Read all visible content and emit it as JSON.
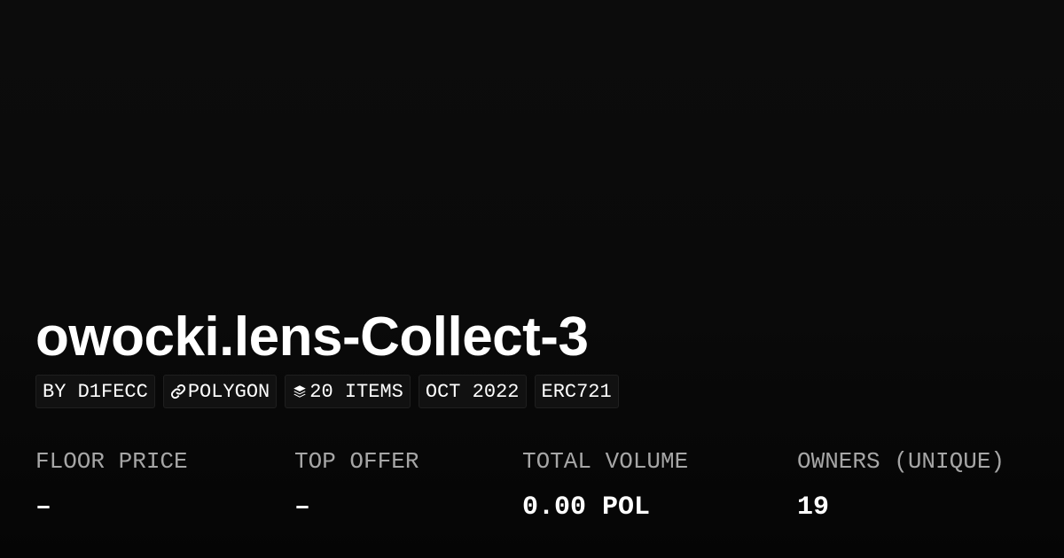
{
  "collection": {
    "title": "owocki.lens-Collect-3"
  },
  "chips": {
    "creator": "BY D1FECC",
    "chain": "POLYGON",
    "chain_icon": "link-icon",
    "items": "20 ITEMS",
    "items_icon": "layers-icon",
    "date": "OCT 2022",
    "standard": "ERC721"
  },
  "stats": {
    "floor_price": {
      "label": "FLOOR PRICE",
      "value": "–"
    },
    "top_offer": {
      "label": "TOP OFFER",
      "value": "–"
    },
    "total_volume": {
      "label": "TOTAL VOLUME",
      "value": "0.00 POL"
    },
    "owners": {
      "label": "OWNERS (UNIQUE)",
      "value": "19"
    }
  },
  "colors": {
    "background": "#0a0a0a",
    "text": "#ffffff",
    "label": "#a6a6a6",
    "chip_background": "#111111"
  }
}
